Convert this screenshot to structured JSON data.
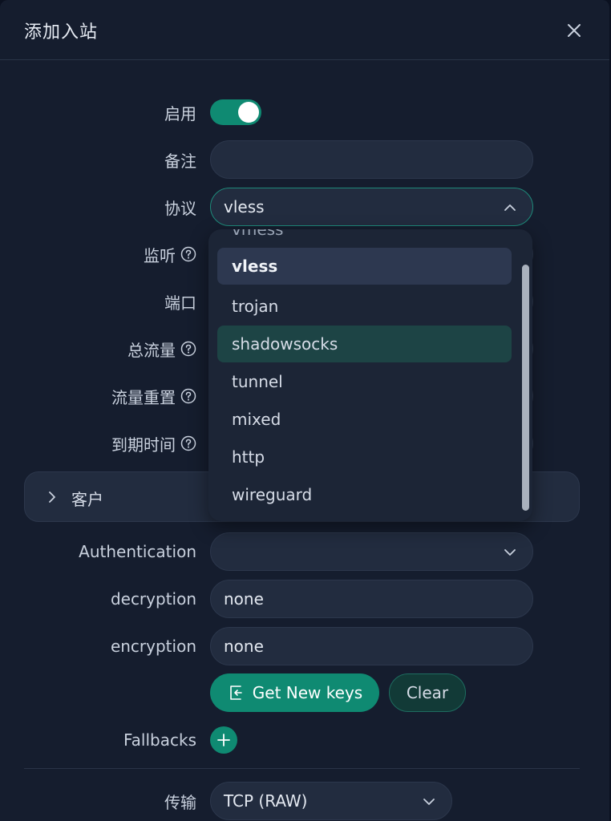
{
  "modal": {
    "title": "添加入站",
    "close_icon": "close-icon"
  },
  "form": {
    "enable": {
      "label": "启用",
      "value": true
    },
    "remark": {
      "label": "备注",
      "value": ""
    },
    "protocol": {
      "label": "协议",
      "value": "vless"
    },
    "listen": {
      "label": "监听"
    },
    "port": {
      "label": "端口"
    },
    "total_traffic": {
      "label": "总流量"
    },
    "traffic_reset": {
      "label": "流量重置"
    },
    "expiry": {
      "label": "到期时间"
    },
    "clients": {
      "label": "客户"
    },
    "authentication": {
      "label": "Authentication",
      "value": ""
    },
    "decryption": {
      "label": "decryption",
      "value": "none"
    },
    "encryption": {
      "label": "encryption",
      "value": "none"
    },
    "get_keys_button": "Get New keys",
    "clear_button": "Clear",
    "fallbacks": {
      "label": "Fallbacks"
    },
    "transport": {
      "label": "传输",
      "value": "TCP (RAW)"
    }
  },
  "protocol_dropdown": {
    "partial_item": "vmess",
    "options": [
      "vless",
      "trojan",
      "shadowsocks",
      "tunnel",
      "mixed",
      "http",
      "wireguard"
    ],
    "selected": "vless",
    "hovered": "shadowsocks"
  },
  "colors": {
    "accent": "#0f8a72",
    "background": "#151d2e",
    "input_bg": "#222c3f"
  }
}
